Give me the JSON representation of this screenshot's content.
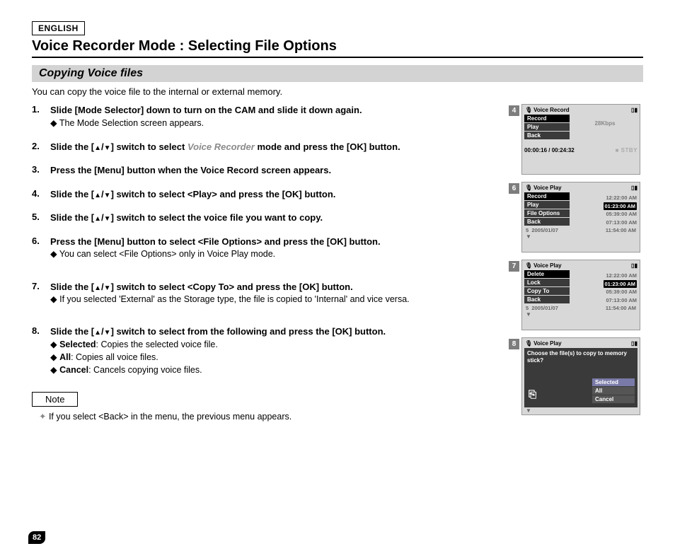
{
  "header": {
    "language": "ENGLISH",
    "title": "Voice Recorder Mode : Selecting File Options"
  },
  "section": {
    "heading": "Copying Voice files",
    "intro": "You can copy the voice file to the internal or external memory."
  },
  "steps": {
    "s1": {
      "main": "Slide [Mode Selector] down to turn on the CAM and slide it down again.",
      "sub1": "The Mode Selection screen appears."
    },
    "s2": {
      "main_a": "Slide the [",
      "main_b": "] switch to select ",
      "ghost": "Voice Recorder",
      "main_c": " mode and press the [OK] button."
    },
    "s3": {
      "main": "Press the [Menu] button when the Voice Record screen appears."
    },
    "s4": {
      "main_a": "Slide the [",
      "main_b": "] switch to select <Play> and press the [OK] button."
    },
    "s5": {
      "main_a": "Slide the [",
      "main_b": "] switch to select the voice file you want to copy."
    },
    "s6": {
      "main": "Press the [Menu] button to select <File Options> and press the [OK] button.",
      "sub1": "You can select <File Options> only in Voice Play mode."
    },
    "s7": {
      "main_a": "Slide the [",
      "main_b": "] switch to select <Copy To> and press the [OK] button.",
      "sub1": "If you selected 'External' as the Storage type, the file is copied to 'Internal' and vice versa."
    },
    "s8": {
      "main_a": "Slide the [",
      "main_b": "] switch to select from the following and press the [OK] button.",
      "sub1_b": "Selected",
      "sub1_r": ": Copies the selected voice file.",
      "sub2_b": "All",
      "sub2_r": ": Copies all voice files.",
      "sub3_b": "Cancel",
      "sub3_r": ": Cancels copying voice files."
    }
  },
  "note": {
    "label": "Note",
    "line": "If you select <Back> in the menu, the previous menu appears."
  },
  "page_number": "82",
  "screens": {
    "s4": {
      "num": "4",
      "title": "Voice Record",
      "menu": [
        "Record",
        "Play",
        "Back"
      ],
      "kbps": "28Kbps",
      "time_cur": "00:00:16",
      "time_tot": "00:24:32",
      "status": "STBY"
    },
    "s6": {
      "num": "6",
      "title": "Voice Play",
      "menu": [
        "Record",
        "Play",
        "File Options",
        "Back"
      ],
      "times": [
        "12:22:00 AM",
        "01:23:00 AM",
        "05:39:00 AM",
        "07:13:00 AM"
      ],
      "foot_idx": "5",
      "foot_date": "2005/01/07",
      "foot_time": "11:54:00 AM"
    },
    "s7": {
      "num": "7",
      "title": "Voice Play",
      "menu": [
        "Delete",
        "Lock",
        "Copy To",
        "Back"
      ],
      "times": [
        "12:22:00 AM",
        "01:23:00 AM",
        "05:39:00 AM",
        "07:13:00 AM"
      ],
      "foot_idx": "5",
      "foot_date": "2005/01/07",
      "foot_time": "11:54:00 AM"
    },
    "s8": {
      "num": "8",
      "title": "Voice Play",
      "question": "Choose the file(s) to copy to memory stick?",
      "opts": [
        "Selected",
        "All",
        "Cancel"
      ]
    }
  }
}
